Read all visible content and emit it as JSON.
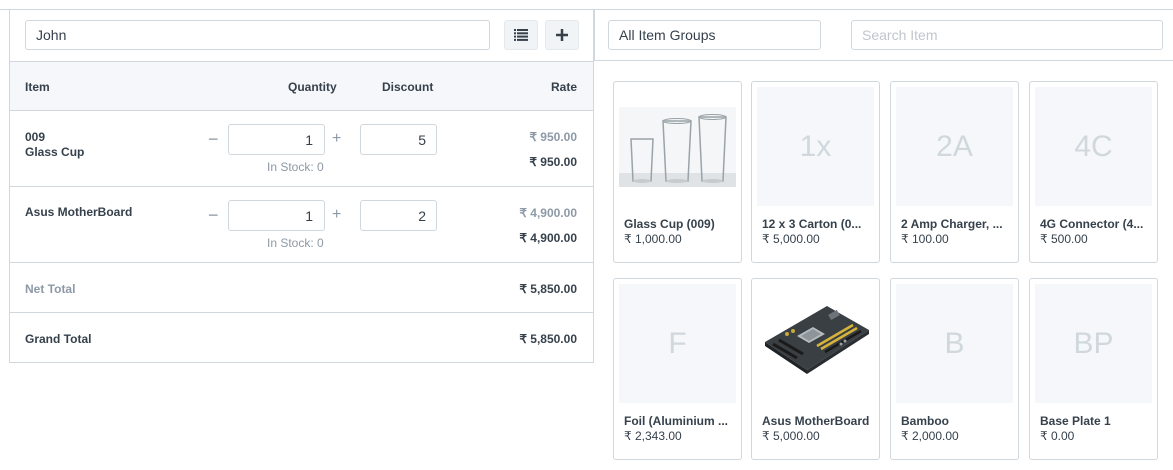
{
  "cart": {
    "customer": "John",
    "header": {
      "item": "Item",
      "quantity": "Quantity",
      "discount": "Discount",
      "rate": "Rate"
    },
    "items": [
      {
        "code": "009",
        "name": "Glass Cup",
        "qty": "1",
        "discount": "5",
        "stock": "In Stock: 0",
        "price_list": "₹ 950.00",
        "rate": "₹ 950.00"
      },
      {
        "code": "",
        "name": "Asus MotherBoard",
        "qty": "1",
        "discount": "2",
        "stock": "In Stock: 0",
        "price_list": "₹ 4,900.00",
        "rate": "₹ 4,900.00"
      }
    ],
    "net_total": {
      "label": "Net Total",
      "value": "₹ 5,850.00"
    },
    "grand_total": {
      "label": "Grand Total",
      "value": "₹ 5,850.00"
    },
    "icons": {
      "list": "list-icon",
      "add": "plus-icon",
      "minus": "minus-icon",
      "plus": "plus-icon"
    }
  },
  "browser": {
    "item_group": "All Item Groups",
    "search_placeholder": "Search Item",
    "items": [
      {
        "name": "Glass Cup (009)",
        "price": "₹ 1,000.00",
        "abbr": "",
        "image": "glass-cups"
      },
      {
        "name": "12 x 3 Carton (0...",
        "price": "₹ 5,000.00",
        "abbr": "1x",
        "image": ""
      },
      {
        "name": "2 Amp Charger, ...",
        "price": "₹ 100.00",
        "abbr": "2A",
        "image": ""
      },
      {
        "name": "4G Connector (4...",
        "price": "₹ 500.00",
        "abbr": "4C",
        "image": ""
      },
      {
        "name": "Foil (Aluminium ...",
        "price": "₹ 2,343.00",
        "abbr": "F",
        "image": ""
      },
      {
        "name": "Asus MotherBoard",
        "price": "₹ 5,000.00",
        "abbr": "",
        "image": "motherboard"
      },
      {
        "name": "Bamboo",
        "price": "₹ 2,000.00",
        "abbr": "B",
        "image": ""
      },
      {
        "name": "Base Plate 1",
        "price": "₹ 0.00",
        "abbr": "BP",
        "image": ""
      }
    ]
  },
  "colors": {
    "border": "#d1d8dd",
    "text": "#36414c",
    "muted": "#8d99a6",
    "header_bg": "#f5f7fa"
  }
}
